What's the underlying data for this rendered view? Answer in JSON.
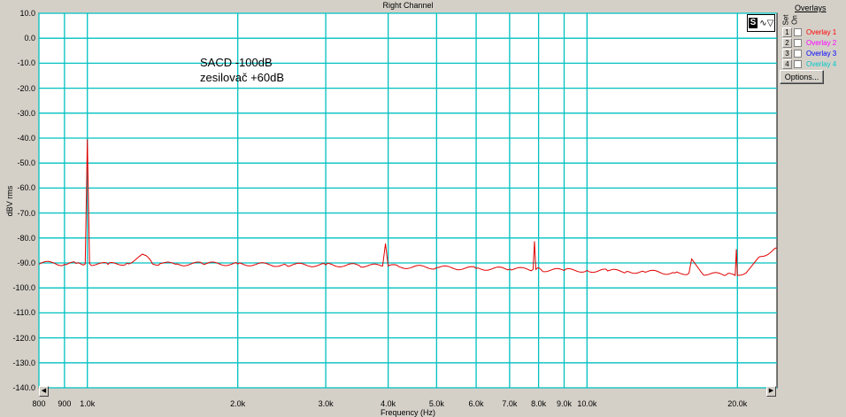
{
  "window": {
    "title": "Right Channel"
  },
  "annotation": {
    "line1": "SACD -100dB",
    "line2": "zesilovač +60dB"
  },
  "overlays": {
    "title": "Overlays",
    "col_set": "Set",
    "col_on": "On",
    "items": [
      {
        "num": "1",
        "label": "Overlay 1",
        "color": "#ff0000",
        "checked": false
      },
      {
        "num": "2",
        "label": "Overlay 2",
        "color": "#ff00ff",
        "checked": false
      },
      {
        "num": "3",
        "label": "Overlay 3",
        "color": "#0000ff",
        "checked": false
      },
      {
        "num": "4",
        "label": "Overlay 4",
        "color": "#00c8c8",
        "checked": false
      }
    ],
    "options_label": "Options..."
  },
  "scroll": {
    "left_icon": "arrow-left-icon",
    "right_icon": "arrow-right-icon"
  },
  "chart_data": {
    "type": "line",
    "title": "Right Channel",
    "xlabel": "Frequency (Hz)",
    "ylabel": "dBV rms",
    "xscale": "log",
    "xlim": [
      800,
      24000
    ],
    "ylim": [
      -140,
      10
    ],
    "grid": true,
    "background": "#ffffff",
    "grid_color": "#00c0c0",
    "line_color": "#e00000",
    "x_ticks": [
      "800",
      "900",
      "1.0k",
      "2.0k",
      "3.0k",
      "4.0k",
      "5.0k",
      "6.0k",
      "7.0k",
      "8.0k",
      "9.0k",
      "10.0k",
      "20.0k"
    ],
    "x_tick_values": [
      800,
      900,
      1000,
      2000,
      3000,
      4000,
      5000,
      6000,
      7000,
      8000,
      9000,
      10000,
      20000
    ],
    "y_ticks": [
      "10.0",
      "0.0",
      "-10.0",
      "-20.0",
      "-30.0",
      "-40.0",
      "-50.0",
      "-60.0",
      "-70.0",
      "-80.0",
      "-90.0",
      "-100.0",
      "-110.0",
      "-120.0",
      "-130.0",
      "-140.0"
    ],
    "y_tick_values": [
      10,
      0,
      -10,
      -20,
      -30,
      -40,
      -50,
      -60,
      -70,
      -80,
      -90,
      -100,
      -110,
      -120,
      -130,
      -140
    ],
    "series": [
      {
        "x": [
          800,
          850,
          900,
          950,
          990,
          1000,
          1010,
          1100,
          1200,
          1300,
          1350,
          1400,
          1500,
          1700,
          2000,
          2500,
          3000,
          3500,
          3900,
          3950,
          4000,
          4200,
          5000,
          6000,
          7000,
          7800,
          7850,
          7900,
          8100,
          9000,
          10000,
          11000,
          12000,
          13000,
          15000,
          16000,
          16200,
          17000,
          19000,
          19800,
          19900,
          20000,
          21000,
          22000,
          24000
        ],
        "y": [
          -90.5,
          -89.8,
          -90.6,
          -90.2,
          -90.4,
          -40.5,
          -90.3,
          -90.6,
          -90.1,
          -86.8,
          -90.4,
          -90.2,
          -90.5,
          -90.3,
          -90.4,
          -90.8,
          -90.8,
          -91.0,
          -91.2,
          -82.2,
          -91.2,
          -91.5,
          -91.8,
          -92.2,
          -92.4,
          -92.6,
          -81.3,
          -92.6,
          -92.8,
          -93.0,
          -93.0,
          -93.2,
          -93.4,
          -93.5,
          -94.0,
          -94.0,
          -88.4,
          -94.2,
          -94.8,
          -95.0,
          -84.5,
          -95.0,
          -93.0,
          -88.0,
          -84.0
        ]
      }
    ]
  }
}
